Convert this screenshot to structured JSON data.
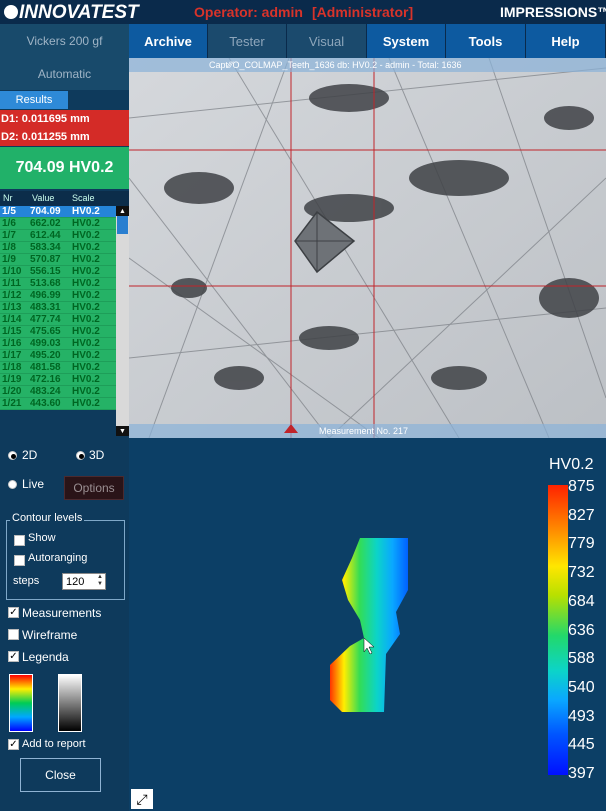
{
  "app": {
    "brand": "INNOVATEST",
    "operator": "Operator: admin",
    "role": "[Administrator]",
    "product": "IMPRESSIONS™"
  },
  "nav": [
    {
      "label": "Archive",
      "active": true
    },
    {
      "label": "Tester",
      "active": false
    },
    {
      "label": "Visual",
      "active": false
    },
    {
      "label": "System",
      "active": true
    },
    {
      "label": "Tools",
      "active": true
    },
    {
      "label": "Help",
      "active": true
    }
  ],
  "left": {
    "method": "Vickers 200 gf",
    "mode": "Automatic",
    "results_tab": "Results",
    "d1": "D1: 0.011695 mm",
    "d2": "D2: 0.011255 mm",
    "result": "704.09 HV0.2"
  },
  "table": {
    "headers": [
      "Nr",
      "Value",
      "Scale"
    ],
    "rows": [
      [
        "1/5",
        "704.09",
        "HV0.2"
      ],
      [
        "1/6",
        "662.02",
        "HV0.2"
      ],
      [
        "1/7",
        "612.44",
        "HV0.2"
      ],
      [
        "1/8",
        "583.34",
        "HV0.2"
      ],
      [
        "1/9",
        "570.87",
        "HV0.2"
      ],
      [
        "1/10",
        "556.15",
        "HV0.2"
      ],
      [
        "1/11",
        "513.68",
        "HV0.2"
      ],
      [
        "1/12",
        "496.99",
        "HV0.2"
      ],
      [
        "1/13",
        "483.31",
        "HV0.2"
      ],
      [
        "1/14",
        "477.74",
        "HV0.2"
      ],
      [
        "1/15",
        "475.65",
        "HV0.2"
      ],
      [
        "1/16",
        "499.03",
        "HV0.2"
      ],
      [
        "1/17",
        "495.20",
        "HV0.2"
      ],
      [
        "1/18",
        "481.58",
        "HV0.2"
      ],
      [
        "1/19",
        "472.16",
        "HV0.2"
      ],
      [
        "1/20",
        "483.24",
        "HV0.2"
      ],
      [
        "1/21",
        "443.60",
        "HV0.2"
      ]
    ]
  },
  "image": {
    "top_caption": "Capt⁄⁄⁄O_COLMAP_Teeth_1636 db: HV0.2 - admin - Total: 1636",
    "bottom_caption": "Measurement No. 217"
  },
  "controls": {
    "view_2d": "2D",
    "view_3d": "3D",
    "live": "Live",
    "options": "Options",
    "contour_title": "Contour levels",
    "show": "Show",
    "autoranging": "Autoranging",
    "steps_label": "steps",
    "steps_value": "120",
    "measurements": "Measurements",
    "wireframe": "Wireframe",
    "legenda": "Legenda",
    "add_to_report": "Add to report",
    "close": "Close"
  },
  "legend": {
    "title": "HV0.2",
    "ticks": [
      "875",
      "827",
      "779",
      "732",
      "684",
      "636",
      "588",
      "540",
      "493",
      "445",
      "397"
    ],
    "colors": {
      "high": "#ff2200",
      "mid": "#22d86b",
      "low": "#0010ff"
    }
  }
}
